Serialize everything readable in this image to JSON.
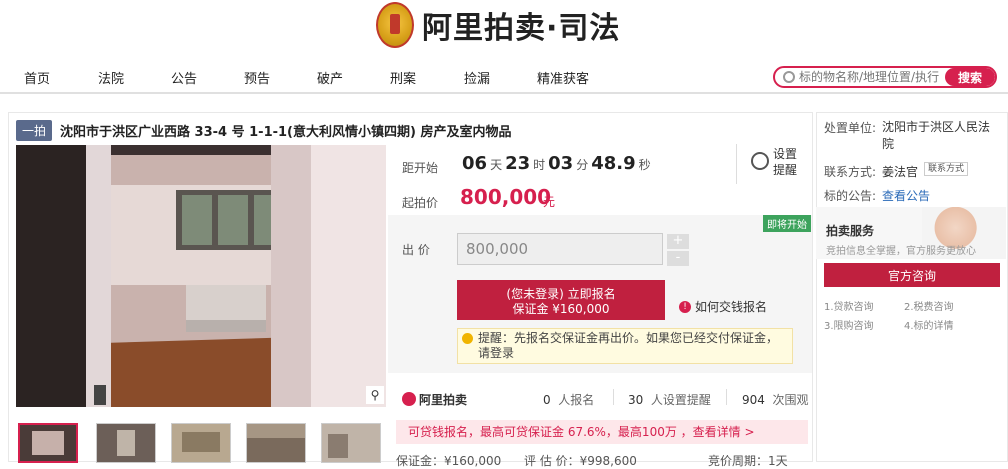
{
  "brand": {
    "name": "阿里拍卖·司法"
  },
  "nav": [
    "首页",
    "法院",
    "公告",
    "预告",
    "破产",
    "刑案",
    "捡漏",
    "精准获客"
  ],
  "search": {
    "placeholder": "标的物名称/地理位置/执行",
    "button": "搜索"
  },
  "item": {
    "badge": "一拍",
    "title": "沈阳市于洪区广业西路 33-4 号 1-1-1(意大利风情小镇四期) 房产及室内物品"
  },
  "countdown": {
    "label": "距开始",
    "days": "06",
    "days_unit": "天",
    "hours": "23",
    "hours_unit": "时",
    "minutes": "03",
    "minutes_unit": "分",
    "seconds": "48.9",
    "seconds_unit": "秒"
  },
  "remind": {
    "label": "设置提醒"
  },
  "start_price": {
    "label": "起拍价",
    "value": "800,000",
    "unit": "元"
  },
  "bid": {
    "tag": "即将开始",
    "label": "出 价",
    "value": "800,000",
    "plus": "+",
    "minus": "-",
    "signup_line1": "(您未登录) 立即报名",
    "signup_line2": "保证金 ¥160,000",
    "howpay": "如何交钱报名",
    "tip": "提醒：先报名交保证金再出价。如果您已经交付保证金，请登录"
  },
  "stats": {
    "brand": "阿里拍卖",
    "signups_n": "0",
    "signups_l": "人报名",
    "reminders_n": "30",
    "reminders_l": "人设置提醒",
    "views_n": "904",
    "views_l": "次围观"
  },
  "loan_banner": "可贷钱报名，最高可贷保证金 67.6%，最高100万 ，查看详情 >",
  "bottom": {
    "deposit": "保证金：¥160,000",
    "assess": "评 估 价：¥998,600",
    "cycle": "竞价周期：1天"
  },
  "side": {
    "unit_label": "处置单位:",
    "unit_value": "沈阳市于洪区人民法院",
    "contact_label": "联系方式:",
    "contact_value": "姜法官",
    "contact_tag": "联系方式",
    "notice_label": "标的公告:",
    "notice_link": "查看公告",
    "svc_title": "拍卖服务",
    "svc_sub": "竞拍信息全掌握，官方服务更放心",
    "consult": "官方咨询",
    "links": [
      "1.贷款咨询",
      "2.税费咨询",
      "3.限购咨询",
      "4.标的详情"
    ]
  }
}
